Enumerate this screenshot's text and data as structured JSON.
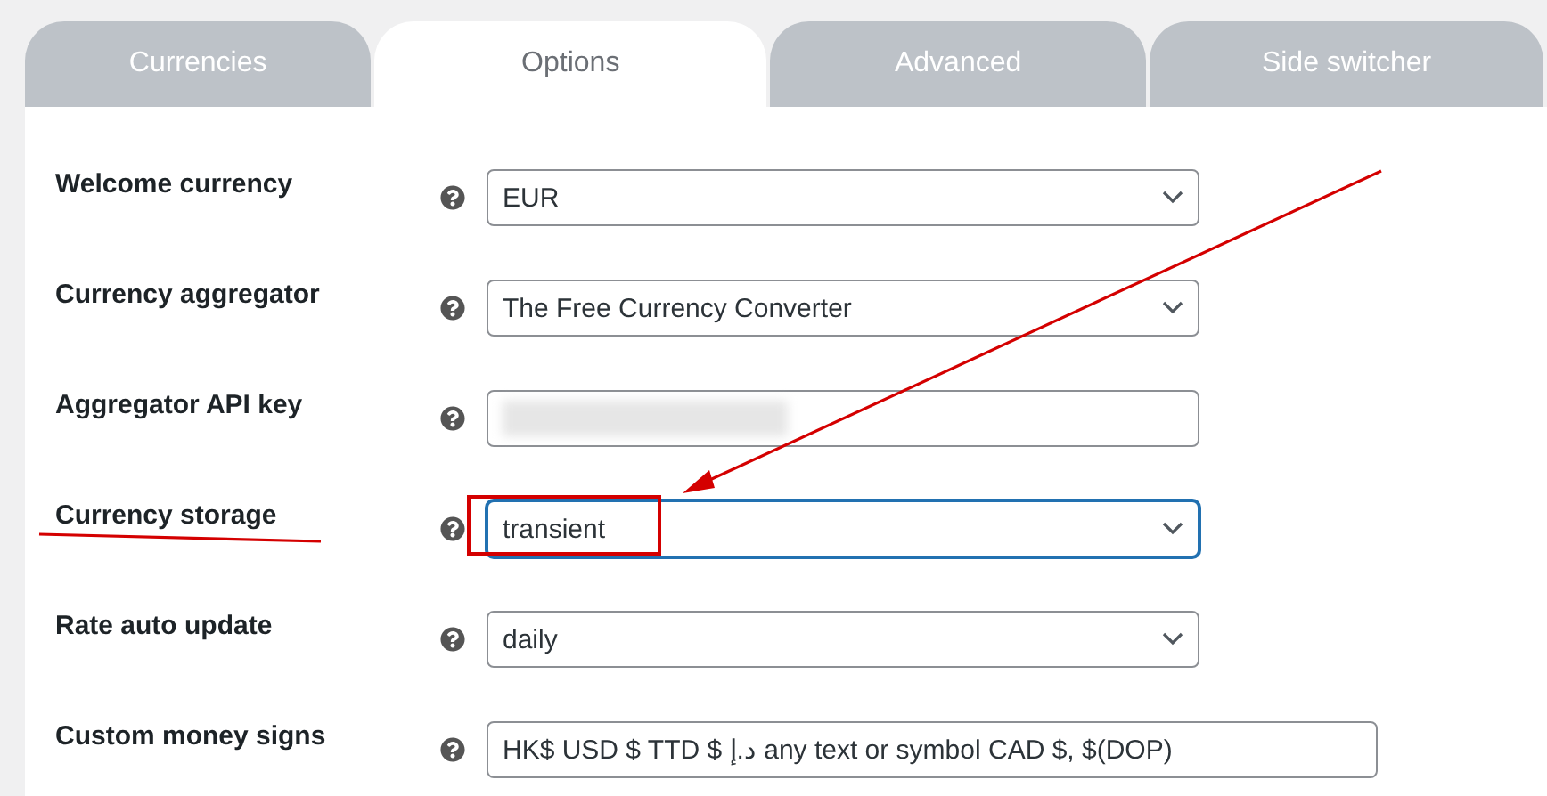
{
  "tabs": [
    {
      "label": "Currencies",
      "selected": false
    },
    {
      "label": "Options",
      "selected": true
    },
    {
      "label": "Advanced",
      "selected": false
    },
    {
      "label": "Side switcher",
      "selected": false
    }
  ],
  "settings": [
    {
      "kind": "select",
      "label": "Welcome currency",
      "value": "EUR",
      "focused": false
    },
    {
      "kind": "select",
      "label": "Currency aggregator",
      "value": "The Free Currency Converter",
      "focused": false
    },
    {
      "kind": "blurred",
      "label": "Aggregator API key"
    },
    {
      "kind": "select",
      "label": "Currency storage",
      "value": "transient",
      "focused": true
    },
    {
      "kind": "select",
      "label": "Rate auto update",
      "value": "daily",
      "focused": false
    },
    {
      "kind": "text",
      "label": "Custom money signs",
      "value": "HK$ USD $ TTD $ د.إ any text or symbol CAD $, $(DOP)"
    }
  ],
  "annotations": [
    {
      "kind": "arrow"
    },
    {
      "kind": "box"
    },
    {
      "kind": "underline"
    }
  ]
}
